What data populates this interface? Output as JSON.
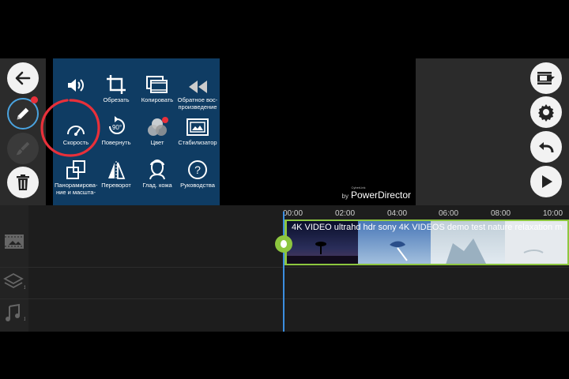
{
  "menu": {
    "items": [
      {
        "label": "",
        "icon": "volume-icon"
      },
      {
        "label": "Обрезать",
        "icon": "crop-icon"
      },
      {
        "label": "Копировать",
        "icon": "copy-icon"
      },
      {
        "label": "Обратное вос-\nпроизведение",
        "icon": "reverse-icon"
      },
      {
        "label": "Скорость",
        "icon": "speed-icon"
      },
      {
        "label": "Повернуть",
        "icon": "rotate-90-icon",
        "badge": "90°"
      },
      {
        "label": "Цвет",
        "icon": "color-icon"
      },
      {
        "label": "Стабилизатор",
        "icon": "stabilizer-icon"
      },
      {
        "label": "Панорамирова-\nние и масшта-",
        "icon": "pan-zoom-icon"
      },
      {
        "label": "Переворот",
        "icon": "flip-icon"
      },
      {
        "label": "Глад. кожа",
        "icon": "skin-smooth-icon"
      },
      {
        "label": "Руководства",
        "icon": "help-icon"
      }
    ]
  },
  "preview": {
    "brand_by": "by",
    "brand_cyberlink": "CyberLink",
    "brand_name": "PowerDirector"
  },
  "timeline": {
    "ticks": [
      "00:00",
      "02:00",
      "04:00",
      "06:00",
      "08:00",
      "10:00"
    ],
    "clip_title": "4K VIDEO ultrahd hdr sony 4K VIDEOS demo test nature relaxation m"
  },
  "colors": {
    "accent_green": "#8dc63f",
    "playhead_blue": "#3b8ee0",
    "menu_bg": "#0f3c63",
    "highlight_red": "#e8303a"
  }
}
